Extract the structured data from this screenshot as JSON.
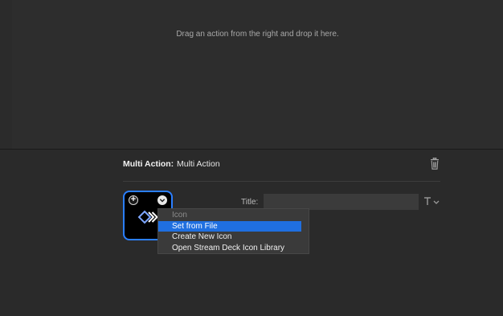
{
  "drop_area": {
    "hint": "Drag an action from the right and drop it here."
  },
  "multi_action": {
    "label": "Multi Action:",
    "value": "Multi Action"
  },
  "key": {
    "plus_symbol": "+",
    "title_label": "Title:",
    "title_value": "",
    "title_placeholder": ""
  },
  "icon_menu": {
    "header": "Icon",
    "items": [
      {
        "label": "Set from File",
        "selected": true
      },
      {
        "label": "Create New Icon",
        "selected": false
      },
      {
        "label": "Open Stream Deck Icon Library",
        "selected": false
      }
    ]
  },
  "icons": {
    "trash": "trash-icon",
    "plus": "plus-icon",
    "chevron": "chevron-down-icon",
    "text_format": "text-format-icon",
    "multi_action": "multi-action-icon"
  },
  "colors": {
    "accent": "#2b7fff",
    "selection": "#1f6fe0",
    "background": "#2b2b2b"
  }
}
